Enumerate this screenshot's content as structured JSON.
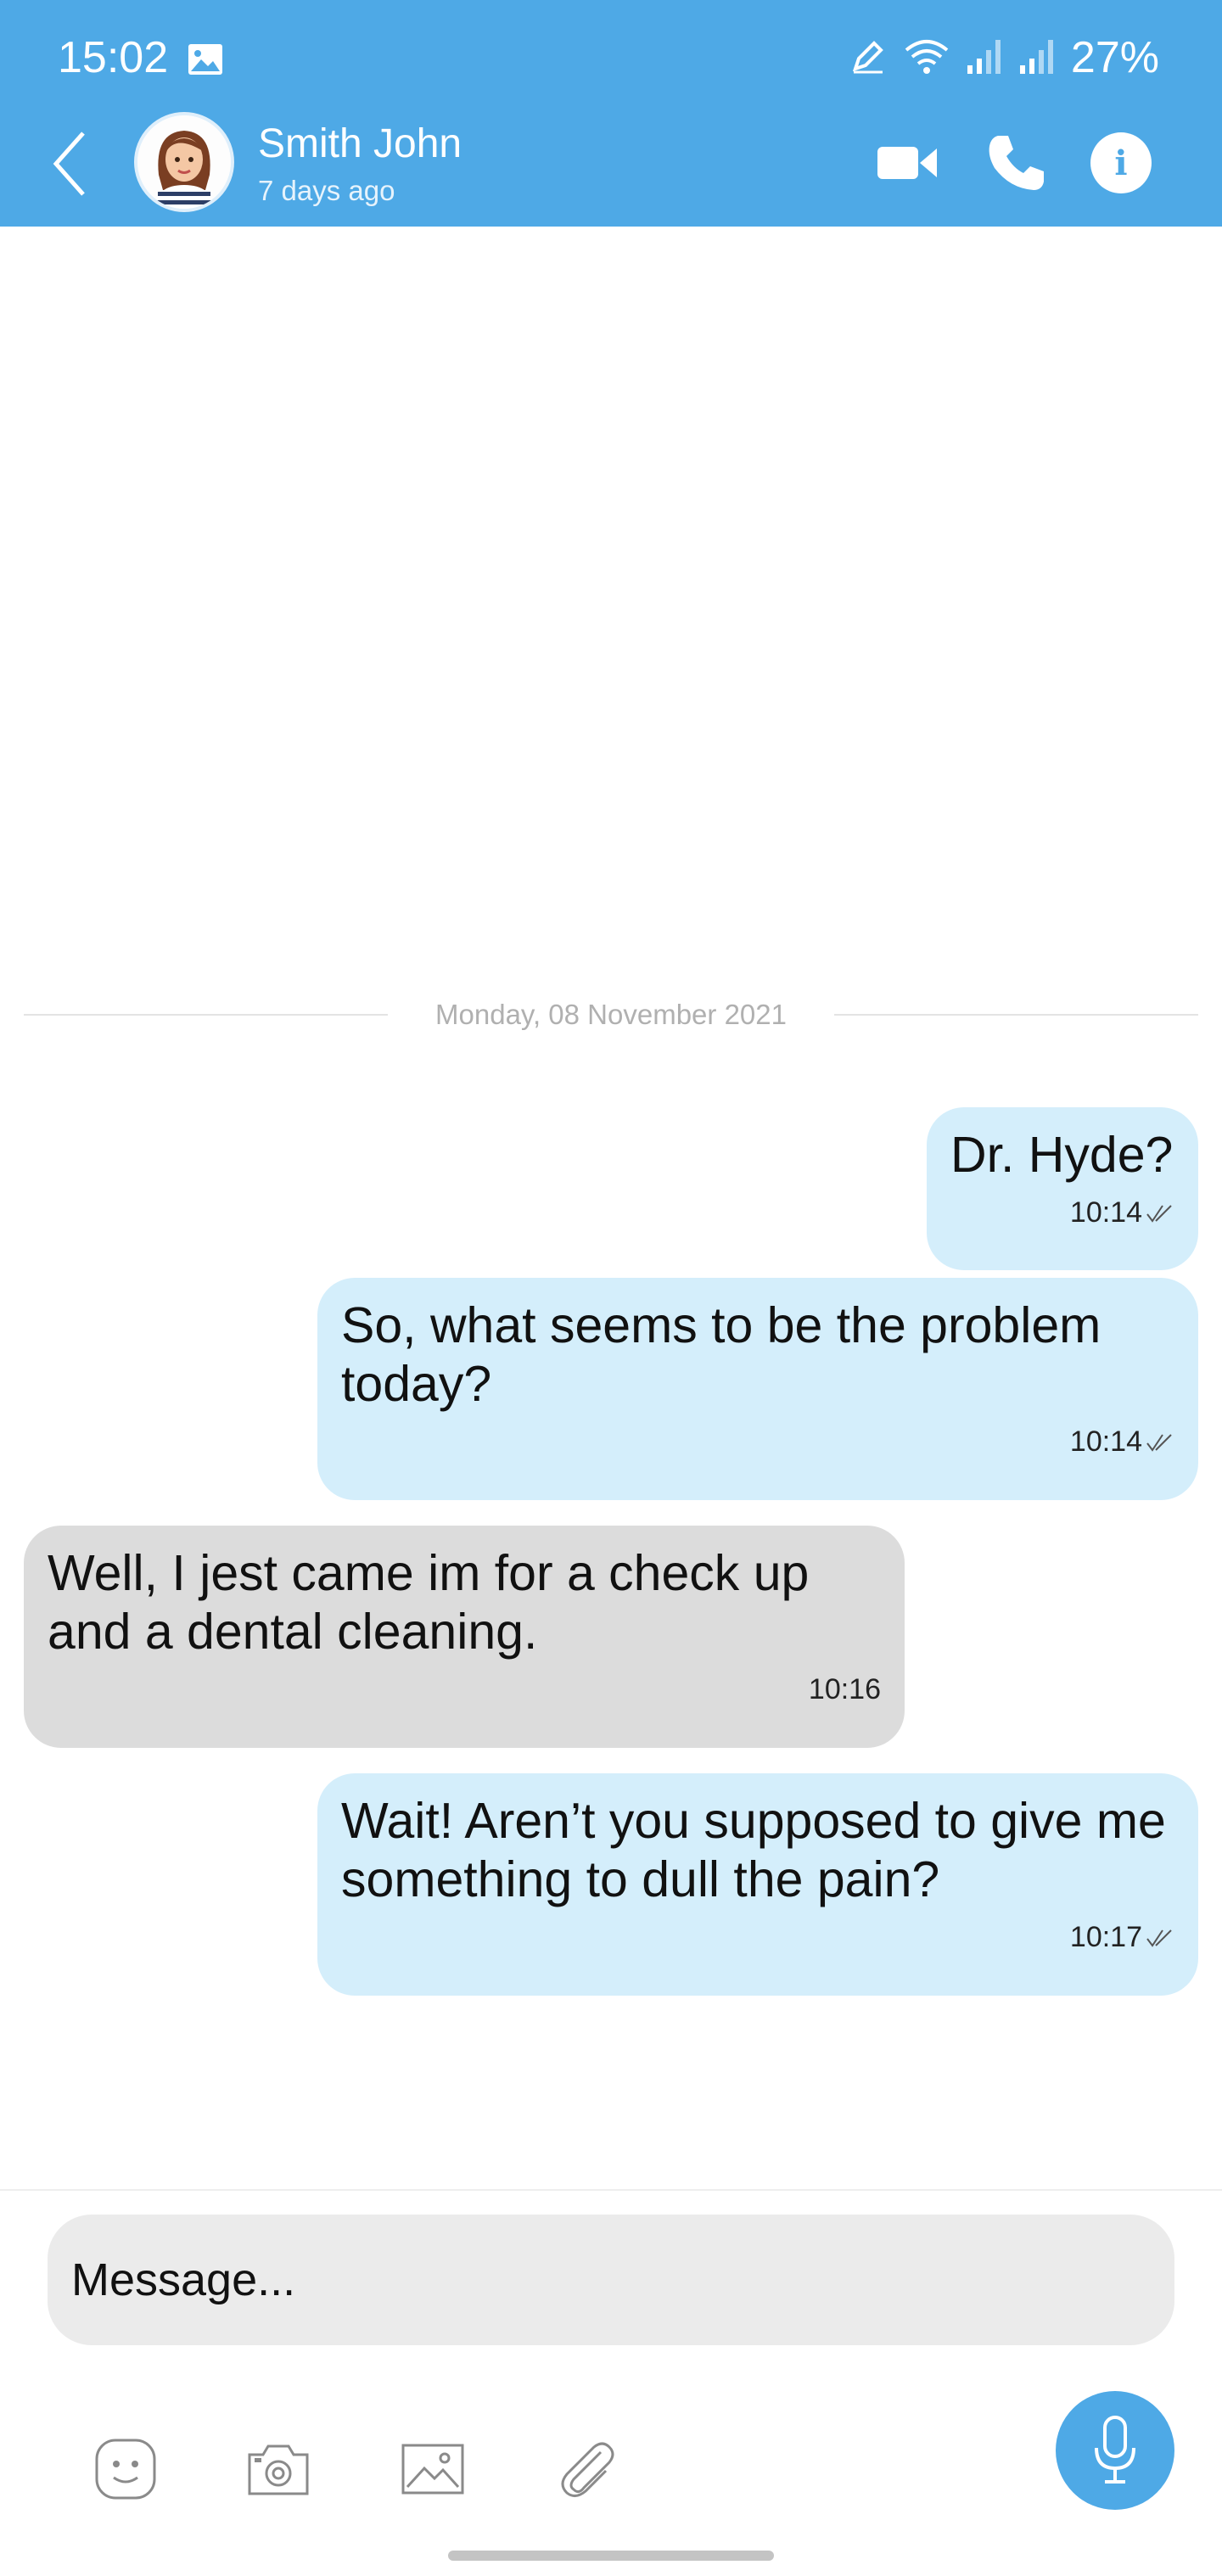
{
  "status_bar": {
    "time": "15:02",
    "battery": "27%",
    "icons": [
      "gallery-icon",
      "edit-icon",
      "wifi-icon",
      "signal-icon",
      "signal-icon"
    ]
  },
  "header": {
    "contact_name": "Smith John",
    "last_seen": "7 days ago",
    "info_label": "i",
    "icons": [
      "back-icon",
      "avatar",
      "video-icon",
      "phone-icon",
      "info-icon"
    ],
    "background_color": "#4ea9e6"
  },
  "chat": {
    "date_divider": "Monday, 08 November 2021",
    "messages": [
      {
        "direction": "outgoing",
        "text": "Dr. Hyde?",
        "time": "10:14",
        "read": true
      },
      {
        "direction": "outgoing",
        "text": "So, what seems to be the problem today?",
        "time": "10:14",
        "read": true
      },
      {
        "direction": "incoming",
        "text": "Well, I jest came im for a check up and a dental cleaning.",
        "time": "10:16"
      },
      {
        "direction": "outgoing",
        "text": "Wait! Aren’t you supposed to give me something to dull the pain?",
        "time": "10:17",
        "read": true
      }
    ],
    "colors": {
      "outgoing_bubble": "#d4eefb",
      "incoming_bubble": "#dcdcdc"
    }
  },
  "composer": {
    "placeholder": "Message...",
    "value": "",
    "tools": [
      "emoji-icon",
      "camera-icon",
      "image-icon",
      "attach-icon"
    ],
    "send_icon": "microphone-icon"
  }
}
